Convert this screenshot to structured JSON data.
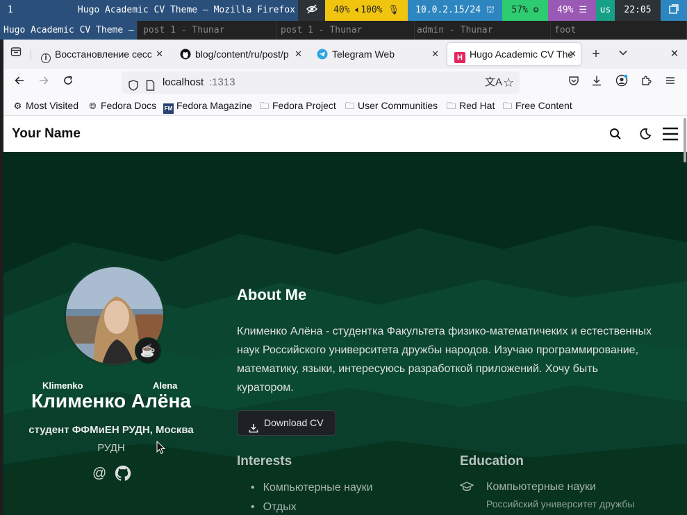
{
  "system_bar": {
    "workspace": "1",
    "window_title": "Hugo Academic CV Theme — Mozilla Firefox",
    "privacy_icon": "eye-slash-icon",
    "brightness": "40%",
    "volume": "100%",
    "network": "10.0.2.15/24",
    "cpu": "57%",
    "memory": "49%",
    "keyboard_layout": "us",
    "time": "22:05",
    "colors": {
      "workspace": "#2a4f7a",
      "audio": "#f1c40f",
      "network": "#2e86c1",
      "cpu": "#2ecc71",
      "memory": "#9b59b6",
      "keyboard": "#16a085"
    }
  },
  "sway_tabs": [
    {
      "label": "Hugo Academic CV Theme —",
      "active": true
    },
    {
      "label": "post 1 - Thunar",
      "active": false
    },
    {
      "label": "post 1 - Thunar",
      "active": false
    },
    {
      "label": "admin - Thunar",
      "active": false
    },
    {
      "label": "foot",
      "active": false
    }
  ],
  "browser": {
    "tabs": [
      {
        "label": "Восстановление сесс",
        "icon": "info-icon"
      },
      {
        "label": "blog/content/ru/post/p",
        "icon": "github-icon"
      },
      {
        "label": "Telegram Web",
        "icon": "telegram-icon"
      },
      {
        "label": "Hugo Academic CV The",
        "icon": "hugo-icon",
        "active": true
      }
    ],
    "new_tab": "+",
    "url_host": "localhost",
    "url_port": ":1313",
    "bookmarks": [
      {
        "label": "Most Visited",
        "icon": "gear-icon"
      },
      {
        "label": "Fedora Docs",
        "icon": "globe-icon"
      },
      {
        "label": "Fedora Magazine",
        "icon": "fedora-magazine-icon"
      },
      {
        "label": "Fedora Project",
        "icon": "folder-icon"
      },
      {
        "label": "User Communities",
        "icon": "folder-icon"
      },
      {
        "label": "Red Hat",
        "icon": "folder-icon"
      },
      {
        "label": "Free Content",
        "icon": "folder-icon"
      }
    ]
  },
  "site": {
    "brand": "Your Name",
    "profile": {
      "first_name_label": "Klimenko",
      "last_name_label": "Alena",
      "name": "Клименко Алёна",
      "role": "студент ФФМиЕН РУДН, Москва",
      "organization": "РУДН",
      "badge_emoji": "☕"
    },
    "about": {
      "heading": "About Me",
      "bio": "Клименко Алёна - студентка Факультета физико-математичеких и естественных наук Российского университета дружбы народов. Изучаю программирование, математику, языки, интересуюсь разработкой приложений. Хочу быть куратором.",
      "bio_lines": [
        "Клименко Алёна - студентка Факультета физико-математичеких и естественных",
        "наук Российского университета дружбы народов. Изучаю программирование,",
        "математику, языки, интересуюсь разработкой приложений. Хочу быть",
        "куратором."
      ],
      "download_cv": "Download CV"
    },
    "interests": {
      "heading": "Interests",
      "items": [
        "Компьютерные науки",
        "Отдых"
      ]
    },
    "education": {
      "heading": "Education",
      "items": [
        {
          "degree": "Компьютерные науки",
          "institution": "Российский университет дружбы"
        }
      ]
    },
    "colors": {
      "hero_bg": "#052b1d",
      "accent": "#0d5a3a"
    }
  }
}
